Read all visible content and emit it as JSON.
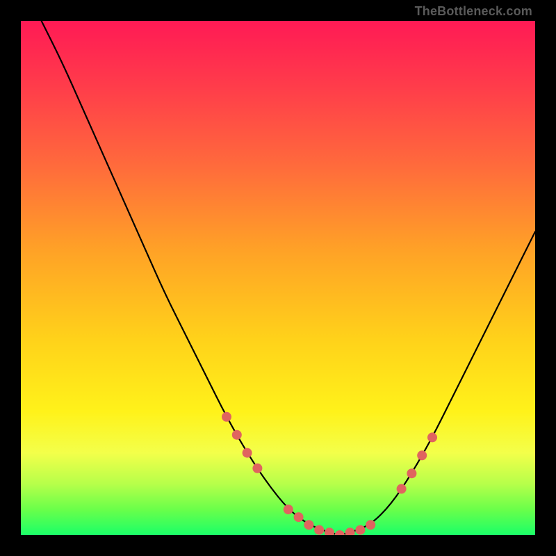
{
  "watermark": "TheBottleneck.com",
  "chart_data": {
    "type": "line",
    "title": "",
    "xlabel": "",
    "ylabel": "",
    "xlim": [
      0,
      100
    ],
    "ylim": [
      0,
      100
    ],
    "grid": false,
    "series": [
      {
        "name": "bottleneck-curve",
        "x": [
          4,
          8,
          12,
          16,
          20,
          24,
          28,
          32,
          36,
          40,
          44,
          48,
          52,
          56,
          60,
          62,
          64,
          68,
          72,
          76,
          80,
          84,
          88,
          92,
          96,
          100
        ],
        "y": [
          100,
          92,
          83,
          74,
          65,
          56,
          47,
          39,
          31,
          23,
          16,
          10,
          5,
          2,
          0.5,
          0,
          0.5,
          2,
          6,
          12,
          19,
          27,
          35,
          43,
          51,
          59
        ]
      }
    ],
    "markers": {
      "name": "highlighted-points",
      "x": [
        40,
        42,
        44,
        46,
        52,
        54,
        56,
        58,
        60,
        62,
        64,
        66,
        68,
        74,
        76,
        78,
        80
      ],
      "y": [
        23,
        19.5,
        16,
        13,
        5,
        3.5,
        2,
        1,
        0.5,
        0,
        0.5,
        1,
        2,
        9,
        12,
        15.5,
        19
      ]
    },
    "background_gradient": {
      "top": "#ff1a55",
      "bottom": "#1aff68",
      "stops": [
        "#ff1a55",
        "#ff6a3c",
        "#ffd21a",
        "#f3ff4a",
        "#1aff68"
      ]
    }
  }
}
